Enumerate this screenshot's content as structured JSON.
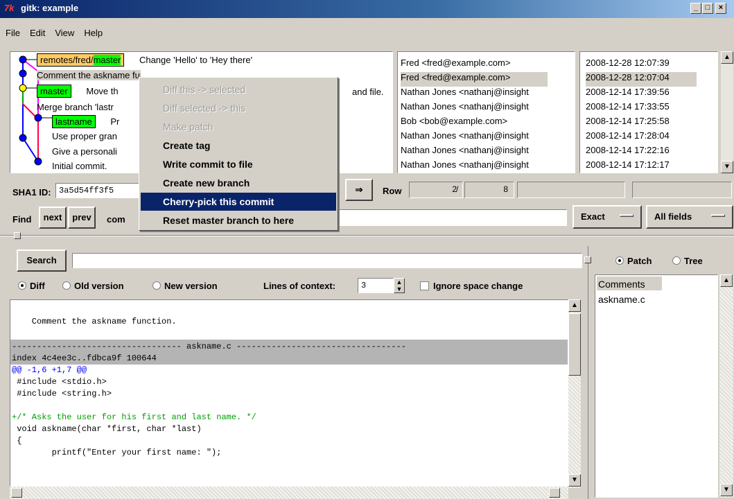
{
  "window": {
    "title": "gitk: example",
    "logo": "7k"
  },
  "menu": [
    "File",
    "Edit",
    "View",
    "Help"
  ],
  "commits": [
    {
      "refs": [
        {
          "label_a": "remotes/fred/",
          "label_b": "master",
          "type": "remote"
        }
      ],
      "message": "Change 'Hello' to 'Hey there'",
      "author": "Fred <fred@example.com>",
      "date": "2008-12-28 12:07:39"
    },
    {
      "refs": [],
      "message": "Comment the askname function",
      "author": "Fred <fred@example.com>",
      "date": "2008-12-28 12:07:04",
      "selected": true
    },
    {
      "refs": [
        {
          "label": "master",
          "type": "head"
        }
      ],
      "message": "Move th",
      "message_tail": "and file.",
      "author": "Nathan Jones <nathanj@insight",
      "date": "2008-12-14 17:39:56"
    },
    {
      "refs": [],
      "message": "Merge branch 'lastr",
      "author": "Nathan Jones <nathanj@insight",
      "date": "2008-12-14 17:33:55"
    },
    {
      "refs": [
        {
          "label": "lastname",
          "type": "head"
        }
      ],
      "message": "Pr",
      "author": "Bob <bob@example.com>",
      "date": "2008-12-14 17:25:58"
    },
    {
      "refs": [],
      "message": "Use proper gran",
      "author": "Nathan Jones <nathanj@insight",
      "date": "2008-12-14 17:28:04"
    },
    {
      "refs": [],
      "message": "Give a personali",
      "author": "Nathan Jones <nathanj@insight",
      "date": "2008-12-14 17:22:16"
    },
    {
      "refs": [],
      "message": "Initial commit.",
      "author": "Nathan Jones <nathanj@insight",
      "date": "2008-12-14 17:12:17"
    }
  ],
  "context_menu": [
    {
      "label": "Diff this -> selected",
      "disabled": true
    },
    {
      "label": "Diff selected -> this",
      "disabled": true
    },
    {
      "label": "Make patch",
      "disabled": true
    },
    {
      "label": "Create tag"
    },
    {
      "label": "Write commit to file"
    },
    {
      "label": "Create new branch"
    },
    {
      "label": "Cherry-pick this commit",
      "highlighted": true
    },
    {
      "label": "Reset master branch to here"
    }
  ],
  "sha": {
    "label": "SHA1 ID:",
    "value": "3a5d54ff3f5"
  },
  "row": {
    "label": "Row",
    "current": "2",
    "sep": "/",
    "total": "8"
  },
  "find": {
    "label": "Find",
    "next": "next",
    "prev": "prev",
    "type_partial": "com",
    "mode": "Exact",
    "fields": "All fields"
  },
  "search": {
    "button": "Search"
  },
  "diff_options": {
    "diff": "Diff",
    "old": "Old version",
    "new": "New version",
    "context_label": "Lines of context:",
    "context_value": "3",
    "ignore_space": "Ignore space change"
  },
  "view_toggle": {
    "patch": "Patch",
    "tree": "Tree"
  },
  "diff_lines": [
    {
      "text": "",
      "kind": "plain"
    },
    {
      "text": "    Comment the askname function.",
      "kind": "plain"
    },
    {
      "text": "",
      "kind": "plain"
    },
    {
      "text": "---------------------------------- askname.c ----------------------------------",
      "kind": "header"
    },
    {
      "text": "index 4c4ee3c..fdbca9f 100644",
      "kind": "header"
    },
    {
      "text": "@@ -1,6 +1,7 @@",
      "kind": "hunk"
    },
    {
      "text": " #include <stdio.h>",
      "kind": "plain"
    },
    {
      "text": " #include <string.h>",
      "kind": "plain"
    },
    {
      "text": "",
      "kind": "plain"
    },
    {
      "text": "+/* Asks the user for his first and last name. */",
      "kind": "add"
    },
    {
      "text": " void askname(char *first, char *last)",
      "kind": "plain"
    },
    {
      "text": " {",
      "kind": "plain"
    },
    {
      "text": "        printf(\"Enter your first name: \");",
      "kind": "plain"
    }
  ],
  "files": [
    "Comments",
    "askname.c"
  ],
  "colors": {
    "head_tag": "#00ff00",
    "remote_tag": "#ffcc66",
    "menu_highlight": "#0a246a",
    "hunk": "#0000ff",
    "add": "#00a000"
  }
}
